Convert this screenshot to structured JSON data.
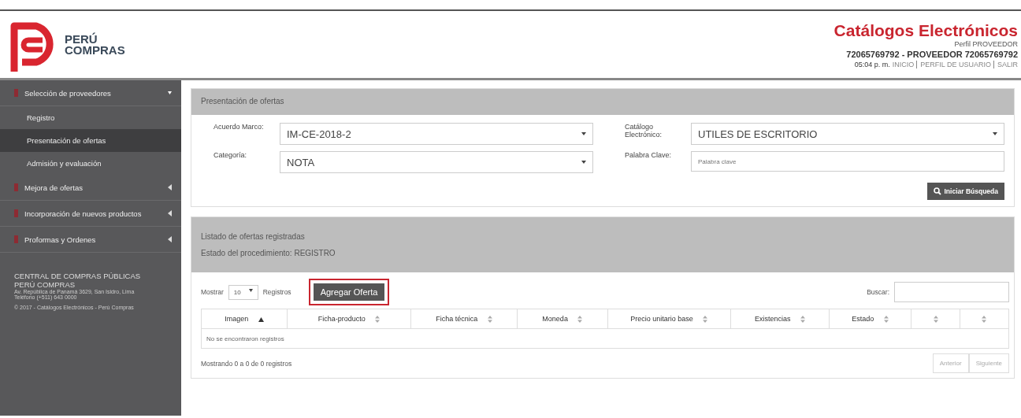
{
  "header": {
    "logo_text": [
      "PERÚ",
      "COMPRAS"
    ],
    "title": "Catálogos Electrónicos",
    "profile": "Perfil PROVEEDOR",
    "user": "72065769792 - PROVEEDOR 72065769792",
    "time": "05:04 p. m.",
    "links": [
      "INICIO",
      "PERFIL DE USUARIO",
      "SALIR"
    ]
  },
  "sidebar": {
    "items": [
      {
        "label": "Selección de proveedores",
        "expanded": true,
        "children": [
          {
            "label": "Registro",
            "selected": false
          },
          {
            "label": "Presentación de ofertas",
            "selected": true
          },
          {
            "label": "Admisión y evaluación",
            "selected": false
          }
        ]
      },
      {
        "label": "Mejora de ofertas",
        "expanded": false
      },
      {
        "label": "Incorporación de nuevos productos",
        "expanded": false
      },
      {
        "label": "Proformas y Ordenes",
        "expanded": false
      }
    ],
    "footer": {
      "org": "CENTRAL DE COMPRAS PÚBLICAS",
      "brand": "PERÚ COMPRAS",
      "address": "Av. República de Panamá 3629, San Isidro, Lima",
      "phone": "Teléfono (+511) 643 0000",
      "copyright": "© 2017 - Catálogos Electrónicos - Perú Compras"
    }
  },
  "search_panel": {
    "title": "Presentación de ofertas",
    "fields": [
      {
        "kind": "select",
        "label": "Acuerdo Marco:",
        "value": "IM-CE-2018-2"
      },
      {
        "kind": "select",
        "label": "Catálogo Electrónico:",
        "value": "UTILES DE ESCRITORIO"
      },
      {
        "kind": "select",
        "label": "Categoría:",
        "value": "NOTA"
      },
      {
        "kind": "text",
        "label": "Palabra Clave:",
        "placeholder": "Palabra clave"
      }
    ],
    "button": "Iniciar Búsqueda"
  },
  "list_panel": {
    "title": "Listado de ofertas registradas",
    "status": "Estado del procedimiento: REGISTRO",
    "show_label": "Mostrar",
    "page_size": "10",
    "records_label": "Registros",
    "add_button": "Agregar Oferta",
    "add_button_highlighted": true,
    "search_label": "Buscar:",
    "table": {
      "columns": [
        {
          "label": "Imagen",
          "sorted": true
        },
        {
          "label": "Ficha-producto",
          "sorted": false
        },
        {
          "label": "Ficha técnica",
          "sorted": false
        },
        {
          "label": "Moneda",
          "sorted": false
        },
        {
          "label": "Precio unitario base",
          "sorted": false
        },
        {
          "label": "Existencias",
          "sorted": false
        },
        {
          "label": "Estado",
          "sorted": false
        },
        {
          "sorted": false
        },
        {
          "sorted": false
        }
      ],
      "empty_message": "No se encontraron registros"
    },
    "info": "Mostrando 0 a 0 de 0 registros",
    "pagination": [
      "Anterior",
      "Siguiente"
    ]
  }
}
